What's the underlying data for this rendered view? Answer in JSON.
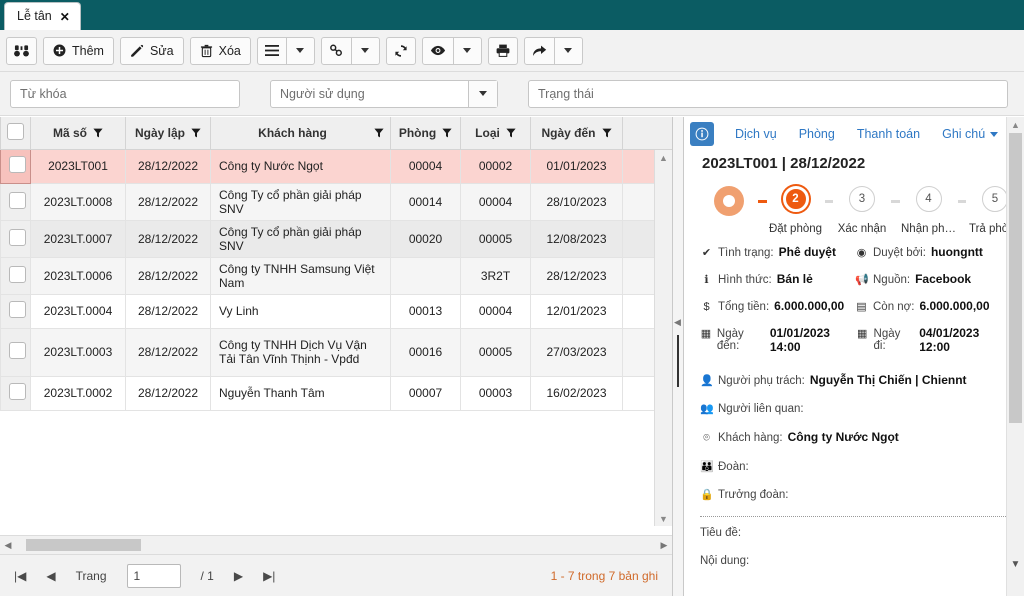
{
  "tab": {
    "label": "Lễ tân",
    "close_icon": "close-icon"
  },
  "toolbar": {
    "search_icon": "binoculars-icon",
    "add_label": "Thêm",
    "edit_label": "Sửa",
    "delete_label": "Xóa",
    "list_icon": "list-icon",
    "link_icon": "link-icon",
    "refresh_icon": "refresh-icon",
    "eye_icon": "eye-icon",
    "print_icon": "print-icon",
    "share_icon": "share-icon",
    "caret_icon": "chevron-down-icon"
  },
  "filters": {
    "keyword_placeholder": "Từ khóa",
    "keyword_value": "",
    "user_placeholder": "Người sử dụng",
    "user_value": "",
    "status_placeholder": "Trạng thái",
    "status_value": ""
  },
  "grid": {
    "columns": [
      {
        "label": "Mã số",
        "filter_icon": "filter-icon"
      },
      {
        "label": "Ngày lập",
        "filter_icon": "filter-icon"
      },
      {
        "label": "Khách hàng",
        "filter_icon": "filter-icon"
      },
      {
        "label": "Phòng",
        "filter_icon": "filter-icon"
      },
      {
        "label": "Loại",
        "filter_icon": "filter-icon"
      },
      {
        "label": "Ngày đến",
        "filter_icon": "filter-icon"
      }
    ],
    "rows": [
      {
        "ma_so": "2023LT001",
        "ngay_lap": "28/12/2022",
        "khach_hang": "Công ty Nước Ngọt",
        "phong": "00004",
        "loai": "00002",
        "ngay_den": "01/01/2023"
      },
      {
        "ma_so": "2023LT.0008",
        "ngay_lap": "28/12/2022",
        "khach_hang": "Công Ty cổ phần giải pháp SNV",
        "phong": "00014",
        "loai": "00004",
        "ngay_den": "28/10/2023"
      },
      {
        "ma_so": "2023LT.0007",
        "ngay_lap": "28/12/2022",
        "khach_hang": "Công Ty cổ phần giải pháp SNV",
        "phong": "00020",
        "loai": "00005",
        "ngay_den": "12/08/2023"
      },
      {
        "ma_so": "2023LT.0006",
        "ngay_lap": "28/12/2022",
        "khach_hang": "Công ty TNHH Samsung Việt Nam",
        "phong": "",
        "loai": "3R2T",
        "ngay_den": "28/12/2023"
      },
      {
        "ma_so": "2023LT.0004",
        "ngay_lap": "28/12/2022",
        "khach_hang": "Vy Linh",
        "phong": "00013",
        "loai": "00004",
        "ngay_den": "12/01/2023"
      },
      {
        "ma_so": "2023LT.0003",
        "ngay_lap": "28/12/2022",
        "khach_hang": "Công ty TNHH Dịch Vụ Vận Tải Tân Vĩnh Thịnh - Vpđd",
        "phong": "00016",
        "loai": "00005",
        "ngay_den": "27/03/2023"
      },
      {
        "ma_so": "2023LT.0002",
        "ngay_lap": "28/12/2022",
        "khach_hang": "Nguyễn Thanh Tâm",
        "phong": "00007",
        "loai": "00003",
        "ngay_den": "16/02/2023"
      }
    ]
  },
  "pager": {
    "first_icon": "first-page-icon",
    "prev_icon": "prev-page-icon",
    "page_label": "Trang",
    "page_value": "1",
    "of_label": "/ 1",
    "next_icon": "next-page-icon",
    "last_icon": "last-page-icon",
    "summary": "1 - 7 trong 7 bản ghi"
  },
  "detail": {
    "info_icon": "info-icon",
    "tabs": [
      "Dịch vụ",
      "Phòng",
      "Thanh toán",
      "Ghi chú"
    ],
    "title": "2023LT001 | 28/12/2022",
    "steps": [
      {
        "num": "",
        "label": ""
      },
      {
        "num": "2",
        "label": "Đặt phòng"
      },
      {
        "num": "3",
        "label": "Xác nhận"
      },
      {
        "num": "4",
        "label": "Nhận ph…"
      },
      {
        "num": "5",
        "label": "Trả phòng"
      }
    ],
    "fields": {
      "tinh_trang_label": "Tình trạng:",
      "tinh_trang_value": "Phê duyệt",
      "duyet_boi_label": "Duyệt bởi:",
      "duyet_boi_value": "huongntt",
      "hinh_thuc_label": "Hình thức:",
      "hinh_thuc_value": "Bán lẻ",
      "nguon_label": "Nguồn:",
      "nguon_value": "Facebook",
      "tong_tien_label": "Tổng tiền:",
      "tong_tien_value": "6.000.000,00",
      "con_no_label": "Còn nợ:",
      "con_no_value": "6.000.000,00",
      "ngay_den_label": "Ngày đến:",
      "ngay_den_value": "01/01/2023  14:00",
      "ngay_di_label": "Ngày đi:",
      "ngay_di_value": "04/01/2023 12:00",
      "nguoi_phu_trach_label": "Người phụ trách:",
      "nguoi_phu_trach_value": "Nguyễn Thị Chiến | Chiennt",
      "nguoi_lien_quan_label": "Người liên quan:",
      "nguoi_lien_quan_value": "",
      "khach_hang_label": "Khách hàng:",
      "khach_hang_value": "Công ty Nước Ngọt",
      "doan_label": "Đoàn:",
      "doan_value": "",
      "truong_doan_label": "Trưởng đoàn:",
      "truong_doan_value": "",
      "tieu_de_label": "Tiêu đề:",
      "noi_dung_label": "Nội dung:"
    }
  },
  "colors": {
    "header_teal": "#0b5c63",
    "selected_row": "#fbd4d0",
    "accent_orange": "#ee5a10",
    "link_blue": "#2f78c4",
    "count_orange": "#d06a2a"
  }
}
